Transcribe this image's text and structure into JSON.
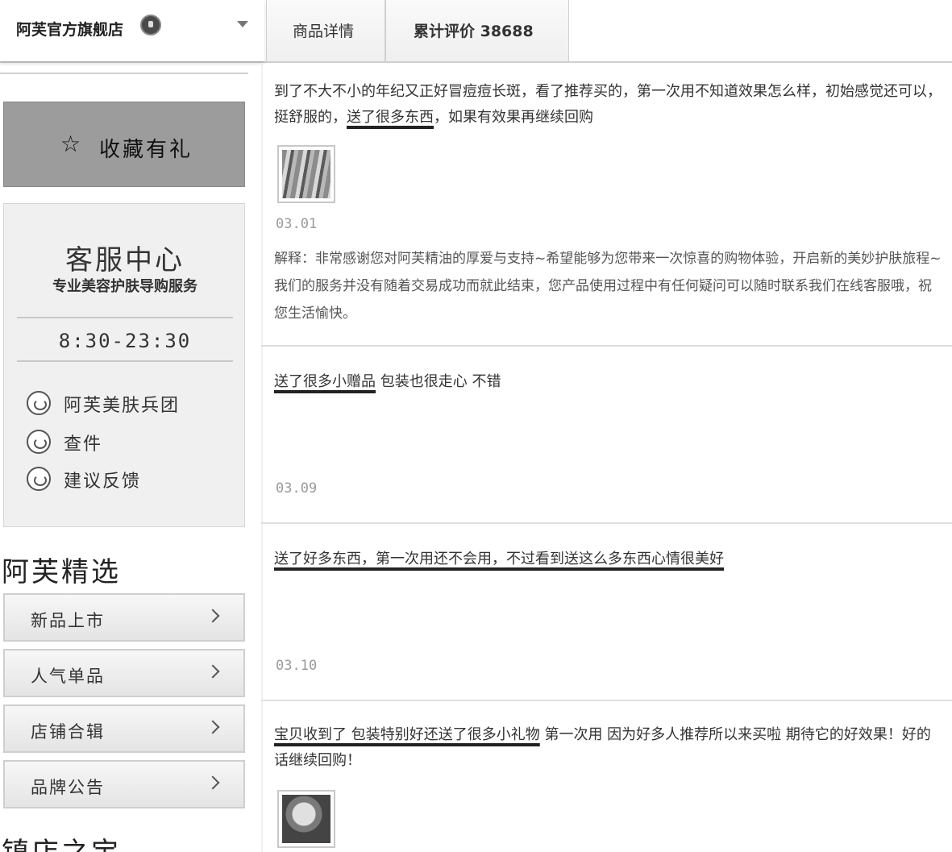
{
  "header": {
    "shop_name": "阿芙官方旗舰店",
    "tabs": [
      {
        "label": "商品详情"
      },
      {
        "label": "累计评价 38688"
      }
    ]
  },
  "sidebar": {
    "favorite_label": "收藏有礼",
    "service": {
      "title": "客服中心",
      "subtitle": "专业美容护肤导购服务",
      "hours": "8:30-23:30",
      "links": [
        {
          "label": "阿芙美肤兵团"
        },
        {
          "label": "查件"
        },
        {
          "label": "建议反馈"
        }
      ]
    },
    "section_title": "阿芙精选",
    "categories": [
      {
        "label": "新品上市"
      },
      {
        "label": "人气单品"
      },
      {
        "label": "店铺合辑"
      },
      {
        "label": "品牌公告"
      }
    ],
    "section_title_2": "镇店之宝"
  },
  "reviews": [
    {
      "text_pre": "到了不大不小的年纪又正好冒痘痘长斑，看了推荐买的，第一次用不知道效果怎么样，初始感觉还可以，挺舒服的，",
      "text_hl": "送了很多东西",
      "text_post": "，如果有效果再继续回购",
      "date": "03.01",
      "reply": "解释：非常感谢您对阿芙精油的厚爱与支持~希望能够为您带来一次惊喜的购物体验，开启新的美妙护肤旅程~我们的服务并没有随着交易成功而就此结束，您产品使用过程中有任何疑问可以随时联系我们在线客服哦，祝您生活愉快。"
    },
    {
      "text_pre": "",
      "text_hl": "送了很多小赠品",
      "text_post": " 包装也很走心 不错",
      "date": "03.09"
    },
    {
      "text_pre": "",
      "text_hl": "送了好多东西，第一次用还不会用，不过看到送这么多东西心情很美好",
      "text_post": "",
      "date": "03.10"
    },
    {
      "text_pre": "",
      "text_hl": "宝贝收到了 包装特别好还送了很多小礼物",
      "text_post": " 第一次用 因为好多人推荐所以来买啦 期待它的好效果！好的话继续回购！"
    }
  ]
}
